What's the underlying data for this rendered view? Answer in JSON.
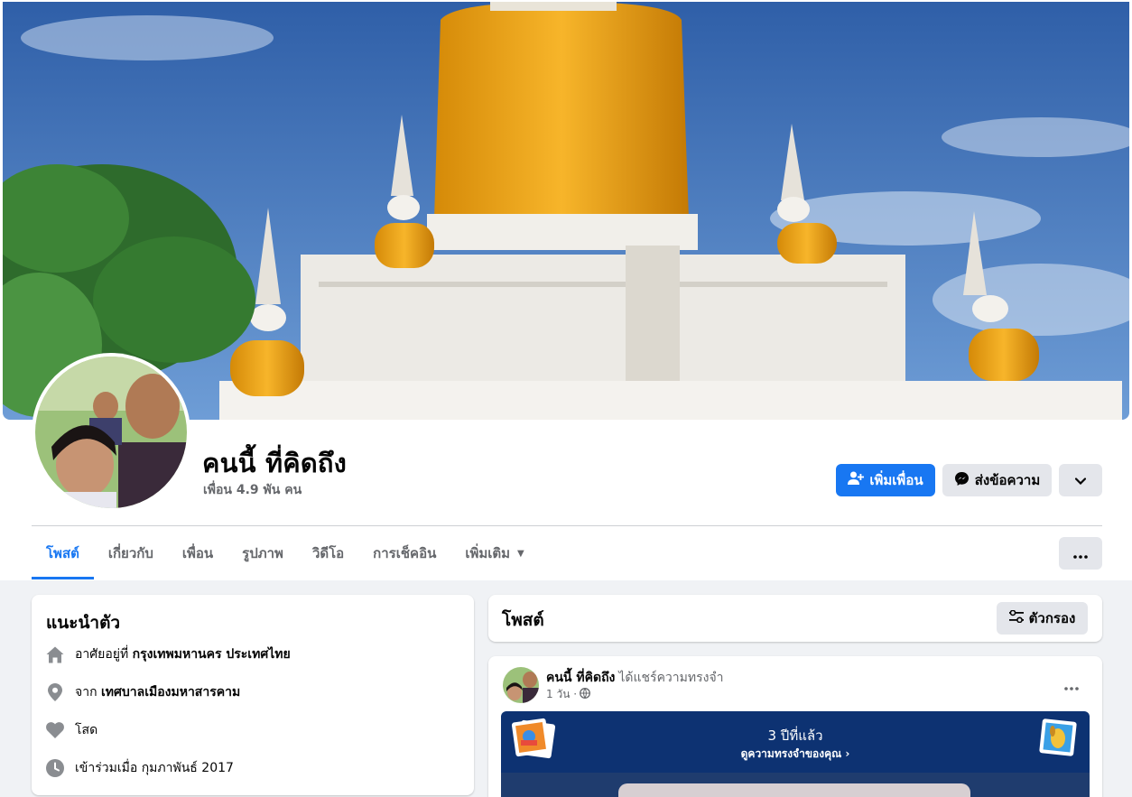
{
  "profile": {
    "name": "คนนี้ ที่คิดถึง",
    "friends": "เพื่อน 4.9 พัน คน"
  },
  "actions": {
    "add_friend": "เพิ่มเพื่อน",
    "message": "ส่งข้อความ"
  },
  "tabs": [
    {
      "label": "โพสต์",
      "active": true
    },
    {
      "label": "เกี่ยวกับ"
    },
    {
      "label": "เพื่อน"
    },
    {
      "label": "รูปภาพ"
    },
    {
      "label": "วิดีโอ"
    },
    {
      "label": "การเช็คอิน"
    },
    {
      "label": "เพิ่มเติม"
    }
  ],
  "intro": {
    "title": "แนะนำตัว",
    "lives_prefix": "อาศัยอยู่ที่",
    "lives_value": "กรุงเทพมหานคร ประเทศไทย",
    "from_prefix": "จาก",
    "from_value": "เทศบาลเมืองมหาสารคาม",
    "relationship": "โสด",
    "joined": "เข้าร่วมเมื่อ กุมภาพันธ์ 2017"
  },
  "posts": {
    "title": "โพสต์",
    "filter_label": "ตัวกรอง"
  },
  "post": {
    "author": "คนนี้ ที่คิดถึง",
    "action": "ได้แชร์ความทรงจำ",
    "time": "1 วัน ·",
    "memory_title": "3 ปีที่แล้ว",
    "memory_link": "ดูความทรงจำของคุณ ›"
  },
  "icons": {
    "add_friend": "person-plus-icon",
    "message": "messenger-icon",
    "more": "chevron-down-icon",
    "tabs_more": "ellipsis-icon",
    "lives": "home-icon",
    "from": "location-pin-icon",
    "relationship": "heart-icon",
    "joined": "clock-icon",
    "filter": "sliders-icon",
    "privacy": "globe-icon"
  },
  "colors": {
    "accent": "#1877f2",
    "secondary_text": "#65676b",
    "background": "#f0f2f5",
    "memory_banner": "#0d3272"
  }
}
